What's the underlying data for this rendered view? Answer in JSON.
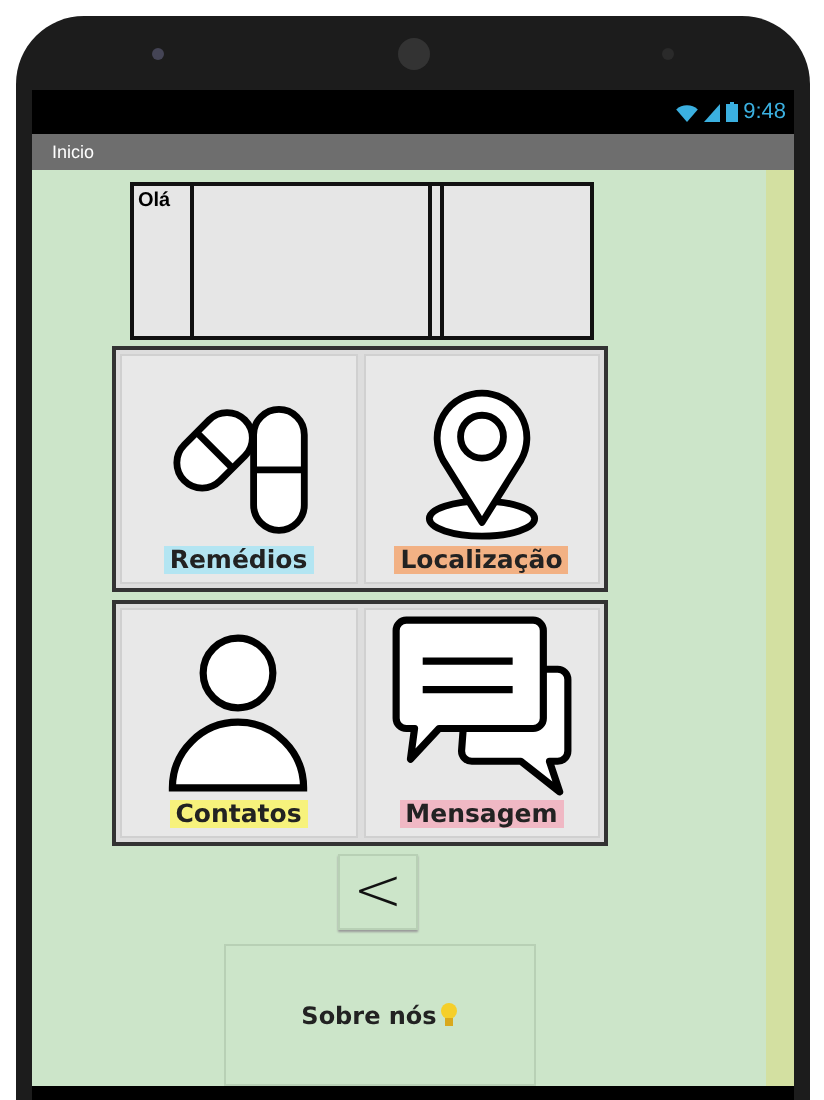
{
  "status_bar": {
    "time": "9:48"
  },
  "title_bar": {
    "title": "Inicio"
  },
  "greeting": {
    "label": "Olá"
  },
  "tiles": [
    {
      "kind": "pills",
      "label": "Remédios",
      "color": "#b3e5f2"
    },
    {
      "kind": "pin",
      "label": "Localização",
      "color": "#f2b184"
    },
    {
      "kind": "person",
      "label": "Contatos",
      "color": "#f7f27c"
    },
    {
      "kind": "chat",
      "label": "Mensagem",
      "color": "#f0b8c4"
    }
  ],
  "back_button": {
    "label": "<"
  },
  "about_button": {
    "label": "Sobre nós"
  }
}
